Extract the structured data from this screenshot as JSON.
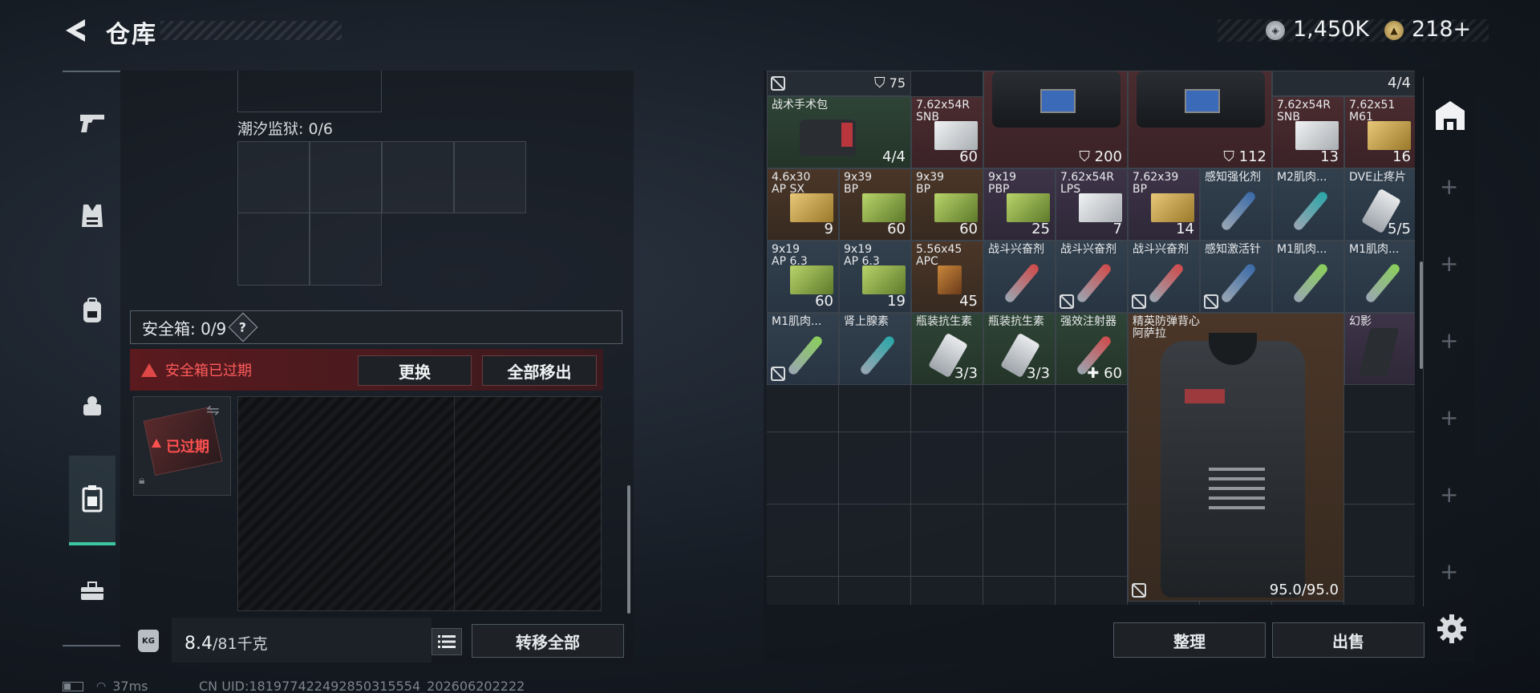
{
  "header": {
    "title": "仓库",
    "money": "1,450K",
    "tokens": "218+"
  },
  "sidebar": {
    "items": [
      {
        "name": "weapons",
        "icon": "pistol-icon"
      },
      {
        "name": "armor",
        "icon": "vest-icon"
      },
      {
        "name": "backpack",
        "icon": "backpack-icon"
      },
      {
        "name": "chest-rig",
        "icon": "rig-icon"
      },
      {
        "name": "safebox",
        "icon": "safebox-icon",
        "active": true
      },
      {
        "name": "toolbox",
        "icon": "toolbox-icon"
      }
    ]
  },
  "left_panel": {
    "prison_label": "潮汐监狱: 0/6",
    "safebox_label": "安全箱: 0/9",
    "safebox_help": "?",
    "expired_text": "安全箱已过期",
    "replace_label": "更换",
    "move_all_out_label": "全部移出",
    "safe_item_status": "已过期",
    "weight_value": "8.4",
    "weight_capacity": "/81千克",
    "weight_icon_text": "KG",
    "transfer_all_label": "转移全部"
  },
  "status_bar": {
    "ping": "37ms",
    "uid": "CN UID:18197742249285031555​4_202606202222"
  },
  "stash": {
    "top_row": {
      "shield_75": "75",
      "count_4_4": "4/4"
    },
    "items": [
      {
        "name": "战术手术包",
        "count": "4/4"
      },
      {
        "name": "7.62x54R\nSNB",
        "count": "60"
      },
      {
        "name": "",
        "count": "200"
      },
      {
        "name": "",
        "count": "112"
      },
      {
        "name": "7.62x54R\nSNB",
        "count": "13"
      },
      {
        "name": "7.62x51\nM61",
        "count": "16"
      },
      {
        "name": "4.6x30\nAP SX",
        "count": "9"
      },
      {
        "name": "9x39\nBP",
        "count": "60"
      },
      {
        "name": "9x39\nBP",
        "count": "60"
      },
      {
        "name": "9x19\nPBP",
        "count": "25"
      },
      {
        "name": "7.62x54R\nLPS",
        "count": "7"
      },
      {
        "name": "7.62x39\nBP",
        "count": "14"
      },
      {
        "name": "感知强化剂",
        "count": ""
      },
      {
        "name": "M2肌肉...",
        "count": ""
      },
      {
        "name": "DVE止疼片",
        "count": "5/5"
      },
      {
        "name": "9x19\nAP 6.3",
        "count": "60"
      },
      {
        "name": "9x19\nAP 6.3",
        "count": "19"
      },
      {
        "name": "5.56x45\nAPC",
        "count": "45"
      },
      {
        "name": "战斗兴奋剂",
        "count": ""
      },
      {
        "name": "战斗兴奋剂",
        "count": ""
      },
      {
        "name": "战斗兴奋剂",
        "count": ""
      },
      {
        "name": "感知激活针",
        "count": ""
      },
      {
        "name": "M1肌肉...",
        "count": ""
      },
      {
        "name": "M1肌肉...",
        "count": ""
      },
      {
        "name": "M1肌肉...",
        "count": ""
      },
      {
        "name": "肾上腺素",
        "count": ""
      },
      {
        "name": "瓶装抗生素",
        "count": "3/3"
      },
      {
        "name": "瓶装抗生素",
        "count": "3/3"
      },
      {
        "name": "强效注射器",
        "count": "60"
      },
      {
        "name": "精英防弹背心\n阿萨拉",
        "count": "95.0/95.0"
      },
      {
        "name": "幻影",
        "count": ""
      }
    ],
    "sort_label": "整理",
    "sell_label": "出售"
  },
  "colors": {
    "accent": "#3cc7a0",
    "warning": "#e04848"
  }
}
